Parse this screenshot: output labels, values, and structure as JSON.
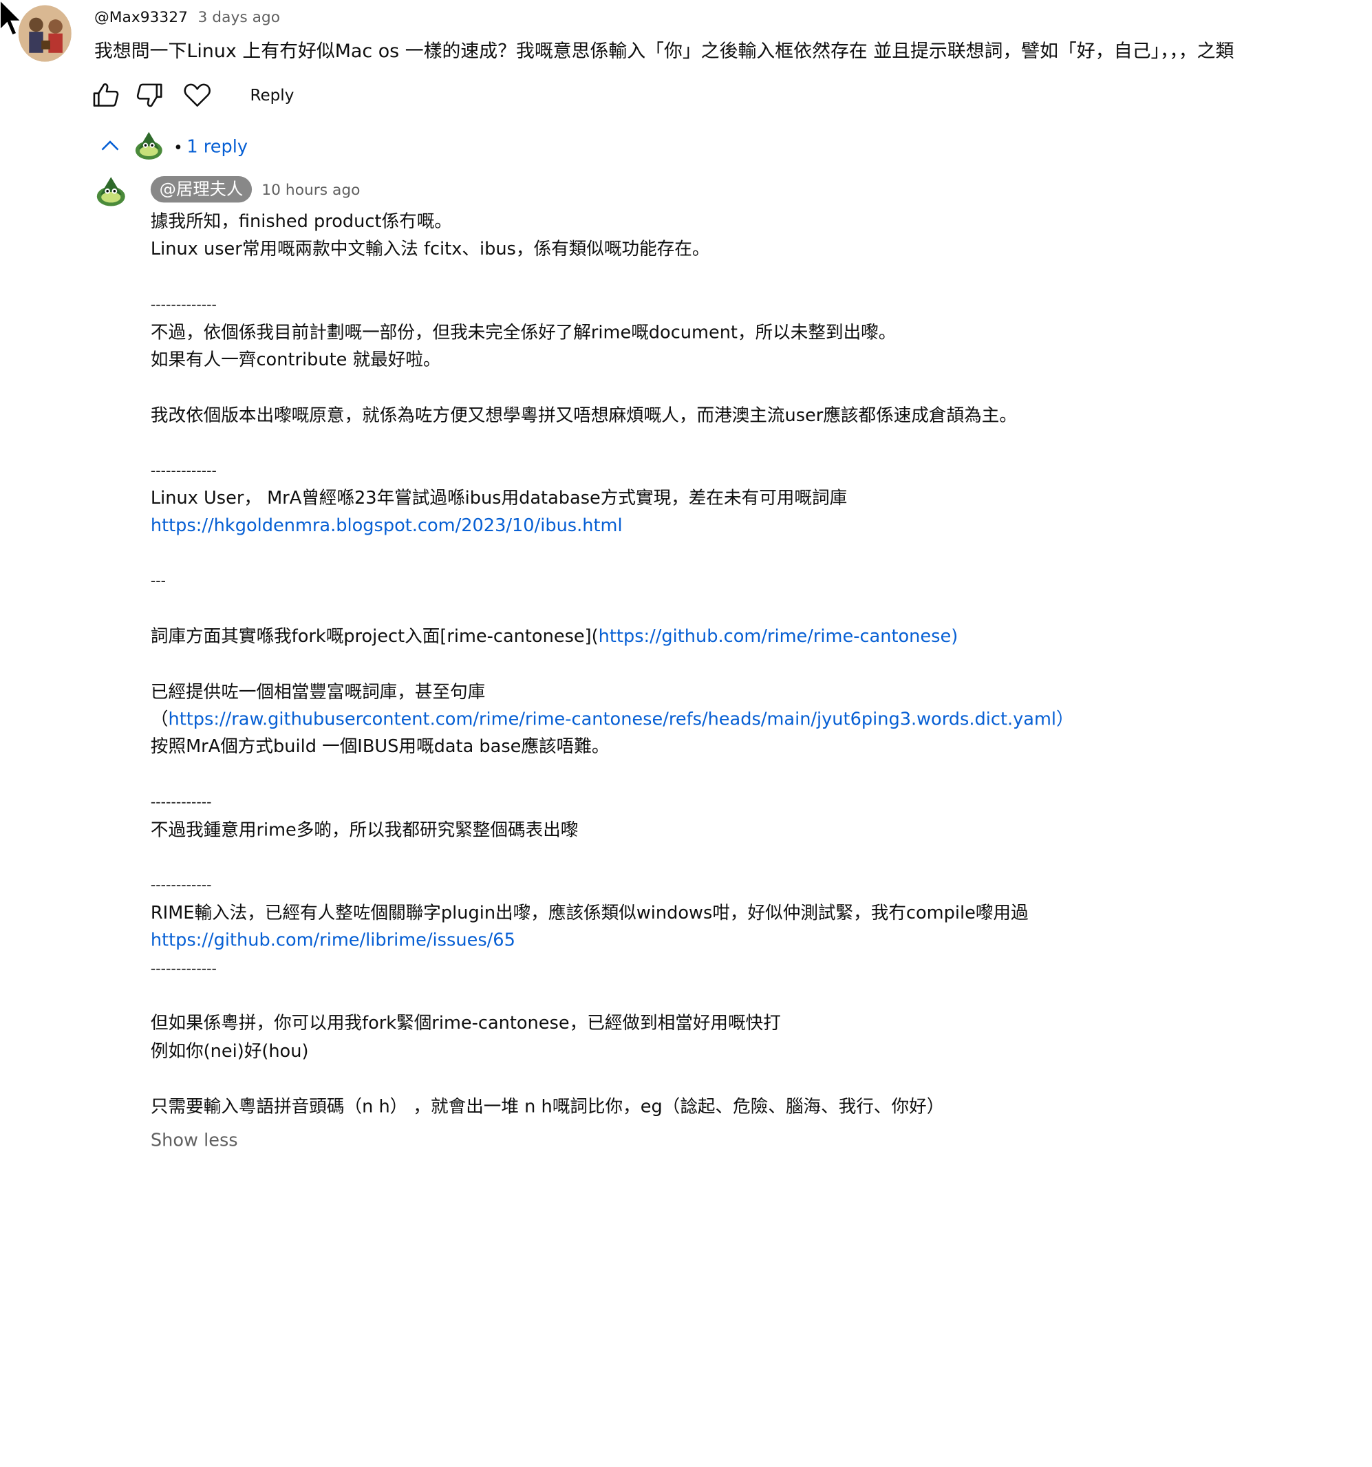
{
  "comment": {
    "author": "@Max93327",
    "time": "3 days ago",
    "text": "我想問一下Linux 上有冇好似Mac os 一樣的速成？我嘅意思係輸入「你」之後輸入框依然存在 並且提示联想詞，譬如「好，自己」，，，之類",
    "actions": {
      "reply_label": "Reply"
    }
  },
  "replies_toggle": {
    "count_label": "1 reply"
  },
  "reply": {
    "author": "@居理夫人",
    "time": "10 hours ago",
    "lines": [
      "據我所知，finished product係冇嘅。",
      "Linux user常用嘅兩款中文輸入法 fcitx、ibus，係有類似嘅功能存在。",
      "",
      "-------------",
      "不過，依個係我目前計劃嘅一部份，但我未完全係好了解rime嘅document，所以未整到出嚟。",
      "如果有人一齊contribute 就最好啦。",
      "",
      "我改依個版本出嚟嘅原意，就係為咗方便又想學粵拼又唔想麻煩嘅人，而港澳主流user應該都係速成倉頡為主。",
      "",
      "-------------",
      " Linux User， MrA曾經喺23年嘗試過喺ibus用database方式實現，差在未有可用嘅詞庫",
      "https://hkgoldenmra.blogspot.com/2023/10/ibus.html",
      "",
      "---",
      "",
      "詞庫方面其實喺我fork嘅project入面[rime-cantonese](",
      "",
      "已經提供咗一個相當豐富嘅詞庫，甚至句庫",
      "（https://raw.githubusercontent.com/rime/rime-cantonese/refs/heads/main/jyut6ping3.words.dict.yaml）",
      "按照MrA個方式build 一個IBUS用嘅data base應該唔難。",
      "",
      "------------",
      "不過我鍾意用rime多啲，所以我都研究緊整個碼表出嚟",
      "",
      "------------",
      "RIME輸入法，已經有人整咗個關聯字plugin出嚟，應該係類似windows咁，好似仲測試緊，我冇compile嚟用過",
      "https://github.com/rime/librime/issues/65",
      "-------------",
      "",
      "但如果係粵拼，你可以用我fork緊個rime-cantonese，已經做到相當好用嘅快打",
      "例如你(nei)好(hou)",
      "",
      "只需要輸入粵語拼音頭碼（n h） ，就會出一堆 n h嘅詞比你，eg（諗起、危險、腦海、我行、你好）"
    ],
    "link_1": "https://hkgoldenmra.blogspot.com/2023/10/ibus.html",
    "link_2_pre": "詞庫方面其實喺我fork嘅project入面[rime-cantonese](",
    "link_2": "https://github.com/rime/rime-cantonese)",
    "link_3_open": "（",
    "link_3": "https://raw.githubusercontent.com/rime/rime-cantonese/refs/heads/main/jyut6ping3.words.dict.yaml）",
    "link_4": "https://github.com/rime/librime/issues/65",
    "show_less_label": "Show less"
  },
  "colors": {
    "link": "#065fd4",
    "muted": "#606060",
    "author_chip": "#888888"
  },
  "icons": [
    "cursor-icon",
    "like-icon",
    "dislike-icon",
    "heart-icon",
    "chevron-up-icon"
  ]
}
